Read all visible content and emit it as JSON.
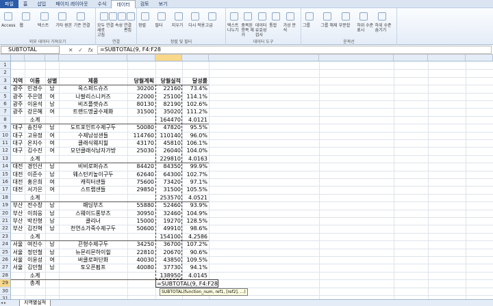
{
  "menu": {
    "tabs": [
      "파일",
      "홈",
      "삽입",
      "페이지 레이아웃",
      "수식",
      "데이터",
      "검토",
      "보기"
    ],
    "active_index": 5
  },
  "ribbon": {
    "groups": [
      {
        "label": "외부 데이터 가져오기",
        "buttons": [
          "Access",
          "웹",
          "텍스트",
          "기타 원본",
          "기존 연결"
        ]
      },
      {
        "label": "연결",
        "buttons": [
          "모두 새로 고침",
          "연결",
          "속성",
          "연결 편집"
        ]
      },
      {
        "label": "정렬 및 필터",
        "buttons": [
          "정렬",
          "필터",
          "지우기",
          "다시 적용",
          "고급"
        ]
      },
      {
        "label": "데이터 도구",
        "buttons": [
          "텍스트 나누기",
          "중복된 항목 제거",
          "데이터 유효성 검사",
          "통합",
          "가상 분석"
        ]
      },
      {
        "label": "윤곽선",
        "buttons": [
          "그룹",
          "그룹 해제",
          "부분합",
          "하위 수준 표시",
          "하위 수준 숨기기"
        ]
      }
    ]
  },
  "formula_bar": {
    "name_box": "SUBTOTAL",
    "formula": "=SUBTOTAL(9, F4:F28"
  },
  "columns": [
    "A",
    "B",
    "C",
    "D",
    "E",
    "F",
    "G",
    "H",
    "I",
    "J",
    "K",
    "L",
    "M"
  ],
  "header_row": {
    "num": "3",
    "cells": [
      "지역",
      "이름",
      "성별",
      "제품",
      "당월계획",
      "당월실적",
      "달성률"
    ]
  },
  "rows": [
    {
      "num": "4",
      "cells": [
        "광주",
        "민경수",
        "남",
        "옥스퍼드슈즈",
        "30200",
        "22160",
        "73.4%"
      ]
    },
    {
      "num": "5",
      "cells": [
        "광주",
        "주은영",
        "여",
        "나팔리스니커즈",
        "22000",
        "25100",
        "114.1%"
      ]
    },
    {
      "num": "6",
      "cells": [
        "광주",
        "이윤석",
        "남",
        "비즈플랫슈즈",
        "80130",
        "82190",
        "102.6%"
      ]
    },
    {
      "num": "7",
      "cells": [
        "광주",
        "강은혜",
        "여",
        "트랜드명굴수제화",
        "31500",
        "35020",
        "111.2%"
      ]
    },
    {
      "num": "8",
      "cells": [
        "",
        "소계",
        "",
        "",
        "",
        "164470",
        "4.0121"
      ],
      "subtotal": true
    },
    {
      "num": "9",
      "cells": [
        "대구",
        "송진우",
        "남",
        "도트포인트수제구두",
        "50080",
        "47820",
        "95.5%"
      ]
    },
    {
      "num": "10",
      "cells": [
        "대구",
        "고유정",
        "여",
        "수제남성샌들",
        "114760",
        "110140",
        "96.0%"
      ]
    },
    {
      "num": "11",
      "cells": [
        "대구",
        "온지수",
        "여",
        "클래식웨지힐",
        "43170",
        "45810",
        "106.1%"
      ]
    },
    {
      "num": "12",
      "cells": [
        "대구",
        "김수진",
        "여",
        "모던클래식남자가방",
        "25030",
        "26040",
        "104.0%"
      ]
    },
    {
      "num": "13",
      "cells": [
        "",
        "소계",
        "",
        "",
        "",
        "229810",
        "4.0163"
      ],
      "subtotal": true
    },
    {
      "num": "14",
      "cells": [
        "대전",
        "경인선",
        "남",
        "비비로퍼슈즈",
        "84420",
        "84350",
        "99.9%"
      ]
    },
    {
      "num": "15",
      "cells": [
        "대전",
        "이준수",
        "남",
        "웨스턴키높이구두",
        "62640",
        "64300",
        "102.7%"
      ]
    },
    {
      "num": "16",
      "cells": [
        "대전",
        "홍은희",
        "여",
        "캐릭터샌들",
        "75600",
        "73420",
        "97.1%"
      ]
    },
    {
      "num": "17",
      "cells": [
        "대전",
        "서가은",
        "여",
        "스트랩샌들",
        "29850",
        "31500",
        "105.5%"
      ]
    },
    {
      "num": "18",
      "cells": [
        "",
        "소계",
        "",
        "",
        "",
        "253570",
        "4.0521"
      ],
      "subtotal": true
    },
    {
      "num": "19",
      "cells": [
        "부산",
        "전수창",
        "남",
        "패딩부츠",
        "55880",
        "52460",
        "93.9%"
      ]
    },
    {
      "num": "20",
      "cells": [
        "부산",
        "이희웅",
        "남",
        "스웨이드롱부츠",
        "30950",
        "32460",
        "104.9%"
      ]
    },
    {
      "num": "21",
      "cells": [
        "부산",
        "박진형",
        "남",
        "클리너",
        "15000",
        "19270",
        "128.5%"
      ]
    },
    {
      "num": "22",
      "cells": [
        "부산",
        "김진혁",
        "남",
        "천연소가죽수제구두",
        "50600",
        "49910",
        "98.6%"
      ]
    },
    {
      "num": "23",
      "cells": [
        "",
        "소계",
        "",
        "",
        "",
        "154100",
        "4.2586"
      ],
      "subtotal": true
    },
    {
      "num": "24",
      "cells": [
        "서울",
        "여진수",
        "남",
        "끈형수제구두",
        "34250",
        "36700",
        "107.2%"
      ]
    },
    {
      "num": "25",
      "cells": [
        "서울",
        "정민철",
        "남",
        "뉴몬리몬하이힐",
        "22810",
        "20670",
        "90.6%"
      ]
    },
    {
      "num": "26",
      "cells": [
        "서울",
        "이윤성",
        "여",
        "버클로퍼단화",
        "40030",
        "43850",
        "109.5%"
      ]
    },
    {
      "num": "27",
      "cells": [
        "서울",
        "김민철",
        "남",
        "토오픈펌프",
        "40080",
        "37730",
        "94.1%"
      ]
    },
    {
      "num": "28",
      "cells": [
        "",
        "소계",
        "",
        "",
        "",
        "138950",
        "4.0145"
      ],
      "subtotal": true
    },
    {
      "num": "29",
      "cells": [
        "",
        "총계",
        "",
        "",
        "",
        "=SUBTOTAL(9, F4:F28",
        ""
      ],
      "total": true
    }
  ],
  "tooltip": "SUBTOTAL(function_num, ref1, [ref2], ...)",
  "sheet_tab": "지역별실적"
}
